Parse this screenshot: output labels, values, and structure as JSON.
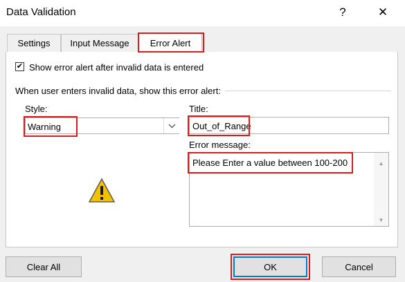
{
  "window": {
    "title": "Data Validation",
    "help_glyph": "?",
    "close_glyph": "✕"
  },
  "tabs": [
    {
      "label": "Settings"
    },
    {
      "label": "Input Message"
    },
    {
      "label": "Error Alert",
      "active": true
    }
  ],
  "checkbox": {
    "label": "Show error alert after invalid data is entered",
    "checked": true
  },
  "group_heading": "When user enters invalid data, show this error alert:",
  "style": {
    "label": "Style:",
    "value": "Warning",
    "icon": "warning-triangle-icon"
  },
  "title_field": {
    "label": "Title:",
    "value": "Out_of_Range"
  },
  "error_message": {
    "label": "Error message:",
    "value": "Please Enter a value between 100-200"
  },
  "buttons": {
    "clear_all": "Clear All",
    "ok": "OK",
    "cancel": "Cancel"
  },
  "colors": {
    "highlight": "#e01818",
    "ok_border": "#0078d7"
  }
}
